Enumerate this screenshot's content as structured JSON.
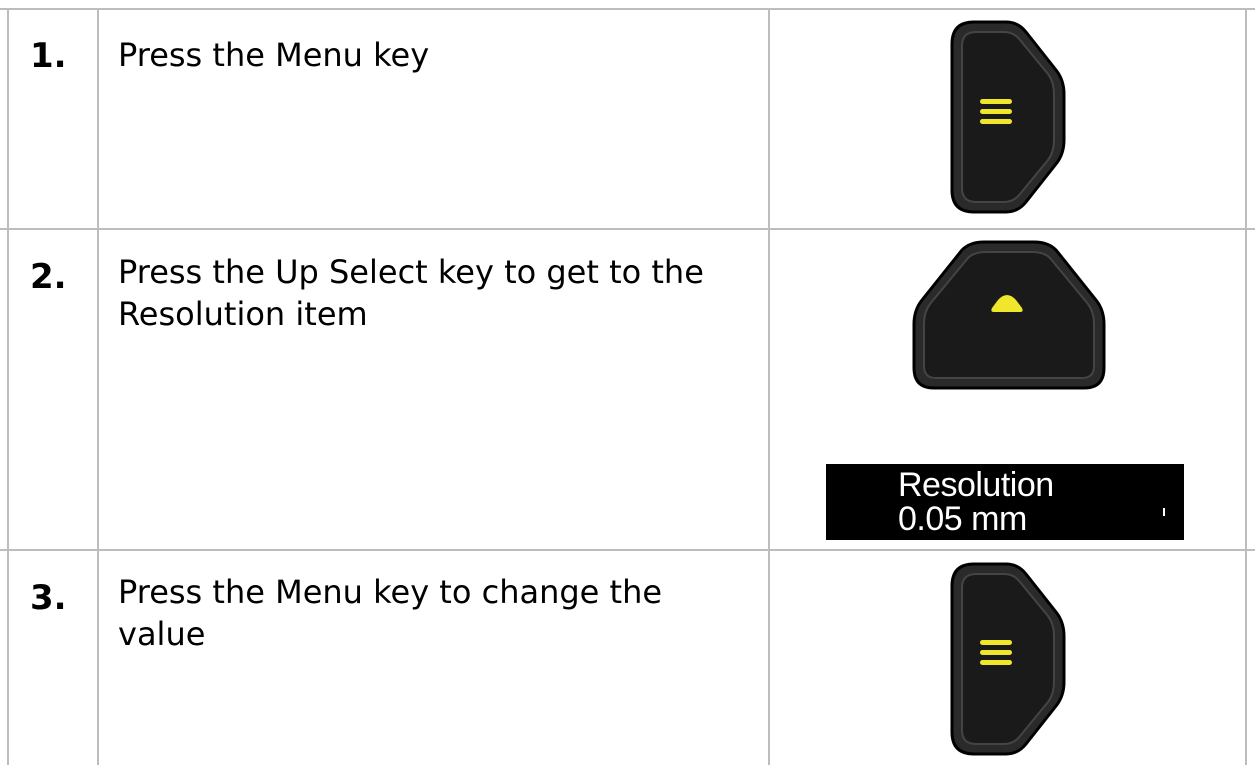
{
  "steps": [
    {
      "number": "1.",
      "text": "Press the Menu key",
      "key": "menu-key"
    },
    {
      "number": "2.",
      "text": "Press the Up Select key to get to the Resolution item",
      "key": "up-select-key"
    },
    {
      "number": "3.",
      "text": "Press the Menu key to change the value",
      "key": "menu-key"
    }
  ],
  "display": {
    "line1": "Resolution",
    "line2": "0.05 mm"
  },
  "colors": {
    "key_body": "#1e1e1e",
    "key_symbol": "#f0e62a",
    "grid_line": "#bdbdbd",
    "display_bg": "#000000",
    "display_text": "#ffffff"
  }
}
